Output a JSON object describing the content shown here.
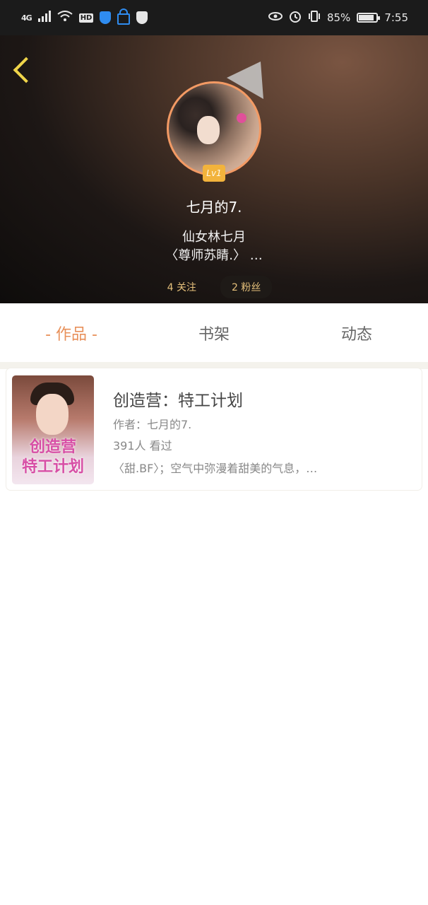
{
  "status_bar": {
    "network": "4G",
    "hd": "HD",
    "battery_percent": "85%",
    "battery_level": 0.85,
    "time": "7:55",
    "icons": [
      "signal-icon",
      "wifi-icon",
      "hd-icon",
      "shield-icon",
      "lock-icon",
      "shield-check-icon",
      "eye-icon",
      "alarm-icon",
      "vibrate-icon",
      "battery-icon"
    ]
  },
  "profile": {
    "username": "七月的7.",
    "bio_line1": "仙女林七月",
    "bio_line2": "〈尊师苏睛.〉 …",
    "level_badge": "Lv1",
    "following": "4 关注",
    "followers": "2 粉丝"
  },
  "tabs": [
    {
      "label": "- 作品 -",
      "active": true
    },
    {
      "label": "书架",
      "active": false
    },
    {
      "label": "动态",
      "active": false
    }
  ],
  "books": [
    {
      "title": "创造营：特工计划",
      "author": "作者：七月的7.",
      "views": "391人 看过",
      "description": "〈甜.BF〉；空气中弥漫着甜美的气息，…",
      "cover_text": "创造营\n特工计划"
    }
  ],
  "colors": {
    "accent": "#e8905a",
    "back_icon": "#f0d54a",
    "stat_text": "#e5c07b",
    "badge": "#f2b33c"
  }
}
